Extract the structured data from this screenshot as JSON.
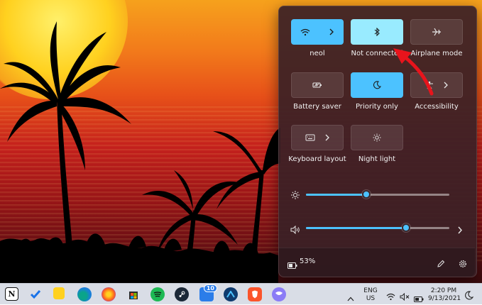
{
  "quick_settings": {
    "tiles": [
      {
        "label": "neol",
        "icon": "wifi-icon",
        "state": "on",
        "has_arrow": true
      },
      {
        "label": "Not connected",
        "icon": "bluetooth-icon",
        "state": "on"
      },
      {
        "label": "Airplane mode",
        "icon": "airplane-icon",
        "state": "off"
      },
      {
        "label": "Battery saver",
        "icon": "battery-saver-icon",
        "state": "off"
      },
      {
        "label": "Priority only",
        "icon": "moon-icon",
        "state": "on"
      },
      {
        "label": "Accessibility",
        "icon": "accessibility-icon",
        "state": "off",
        "has_arrow": true
      },
      {
        "label": "Keyboard layout",
        "icon": "keyboard-icon",
        "state": "off",
        "has_arrow": true
      },
      {
        "label": "Night light",
        "icon": "sun-icon",
        "state": "off"
      }
    ],
    "brightness": {
      "icon": "brightness-icon",
      "level": 0.42
    },
    "volume": {
      "icon": "speaker-icon",
      "level": 0.7,
      "has_arrow": true
    },
    "battery": {
      "icon": "battery-icon",
      "percent": "53%"
    },
    "footer_icons": [
      "pencil-icon",
      "gear-icon"
    ]
  },
  "taskbar": {
    "apps": [
      "notion-icon",
      "todo-icon",
      "sticky-notes-icon",
      "edge-icon",
      "firefox-icon",
      "store-icon",
      "spotify-icon",
      "steam-icon",
      "app-badge-icon",
      "vpn-icon",
      "brave-icon",
      "proton-icon"
    ],
    "badge_count": "10",
    "language": {
      "line1": "ENG",
      "line2": "US"
    },
    "clock": {
      "time": "2:20 PM",
      "date": "9/13/2021"
    }
  },
  "colors": {
    "accent": "#4cc2ff",
    "accent_light": "#99ebff",
    "panel": "#3a2026",
    "annotation_arrow": "#e8141c"
  }
}
